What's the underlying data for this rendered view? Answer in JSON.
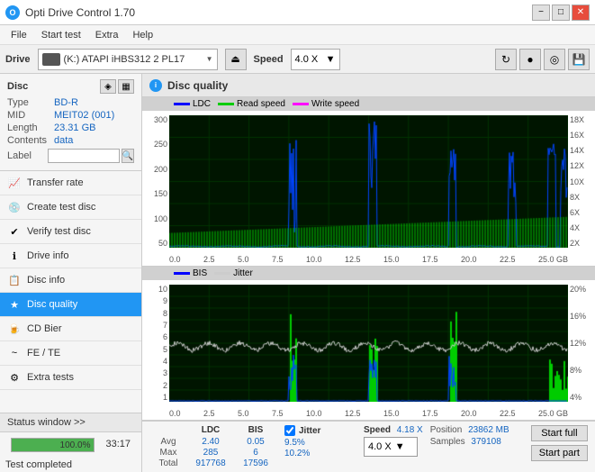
{
  "titleBar": {
    "title": "Opti Drive Control 1.70",
    "icon": "O",
    "minimize": "−",
    "maximize": "□",
    "close": "✕"
  },
  "menu": {
    "items": [
      "File",
      "Start test",
      "Extra",
      "Help"
    ]
  },
  "driveBar": {
    "label": "Drive",
    "driveName": "(K:) ATAPI iHBS312 2 PL17",
    "speedLabel": "Speed",
    "speedValue": "4.0 X"
  },
  "sidebar": {
    "discSection": {
      "title": "Disc",
      "fields": {
        "type": {
          "label": "Type",
          "value": "BD-R"
        },
        "mid": {
          "label": "MID",
          "value": "MEIT02 (001)"
        },
        "length": {
          "label": "Length",
          "value": "23.31 GB"
        },
        "contents": {
          "label": "Contents",
          "value": "data"
        },
        "label": {
          "label": "Label",
          "value": ""
        }
      }
    },
    "navItems": [
      {
        "id": "transfer-rate",
        "label": "Transfer rate",
        "active": false
      },
      {
        "id": "create-test-disc",
        "label": "Create test disc",
        "active": false
      },
      {
        "id": "verify-test-disc",
        "label": "Verify test disc",
        "active": false
      },
      {
        "id": "drive-info",
        "label": "Drive info",
        "active": false
      },
      {
        "id": "disc-info",
        "label": "Disc info",
        "active": false
      },
      {
        "id": "disc-quality",
        "label": "Disc quality",
        "active": true
      },
      {
        "id": "cd-bier",
        "label": "CD Bier",
        "active": false
      },
      {
        "id": "fe-te",
        "label": "FE / TE",
        "active": false
      },
      {
        "id": "extra-tests",
        "label": "Extra tests",
        "active": false
      }
    ],
    "statusWindow": "Status window >>",
    "progressPercent": 100,
    "progressText": "100.0%",
    "timeDisplay": "33:17",
    "statusMsg": "Test completed"
  },
  "content": {
    "title": "Disc quality",
    "legend1": {
      "ldc": "LDC",
      "readSpeed": "Read speed",
      "writeSpeed": "Write speed"
    },
    "legend2": {
      "bis": "BIS",
      "jitter": "Jitter"
    },
    "chart1": {
      "yLeft": [
        "300",
        "250",
        "200",
        "150",
        "100",
        "50"
      ],
      "yRight": [
        "18X",
        "16X",
        "14X",
        "12X",
        "10X",
        "8X",
        "6X",
        "4X",
        "2X"
      ],
      "xAxis": [
        "0.0",
        "2.5",
        "5.0",
        "7.5",
        "10.0",
        "12.5",
        "15.0",
        "17.5",
        "20.0",
        "22.5",
        "25.0 GB"
      ]
    },
    "chart2": {
      "yLeft": [
        "10",
        "9",
        "8",
        "7",
        "6",
        "5",
        "4",
        "3",
        "2",
        "1"
      ],
      "yRight": [
        "20%",
        "16%",
        "12%",
        "8%",
        "4%"
      ],
      "xAxis": [
        "0.0",
        "2.5",
        "5.0",
        "7.5",
        "10.0",
        "12.5",
        "15.0",
        "17.5",
        "20.0",
        "22.5",
        "25.0 GB"
      ]
    },
    "stats": {
      "headers": [
        "LDC",
        "BIS",
        "",
        "Jitter",
        "Speed",
        ""
      ],
      "avg": {
        "ldc": "2.40",
        "bis": "0.05",
        "jitter": "9.5%"
      },
      "max": {
        "ldc": "285",
        "bis": "6",
        "jitter": "10.2%"
      },
      "total": {
        "ldc": "917768",
        "bis": "17596"
      },
      "speedValue": "4.18 X",
      "speedSelect": "4.0 X",
      "position": "23862 MB",
      "samples": "379108",
      "startFull": "Start full",
      "startPart": "Start part"
    }
  }
}
